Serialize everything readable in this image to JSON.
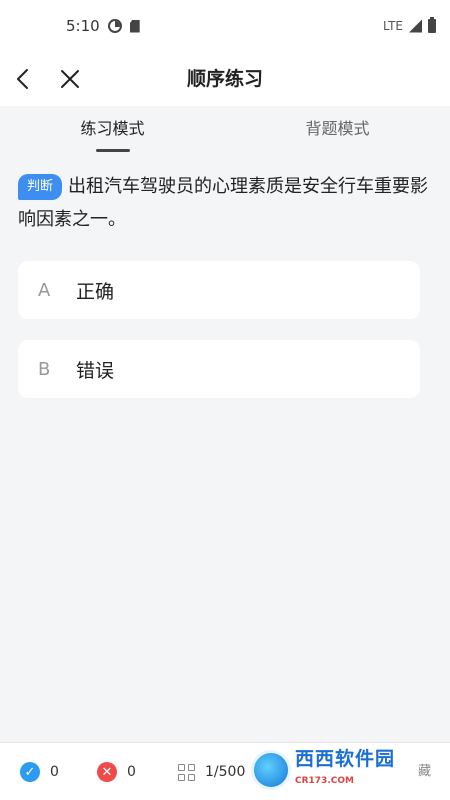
{
  "status": {
    "time": "5:10",
    "network": "LTE"
  },
  "nav": {
    "title": "顺序练习"
  },
  "tabs": [
    {
      "label": "练习模式",
      "active": true
    },
    {
      "label": "背题模式",
      "active": false
    }
  ],
  "question": {
    "badge": "判断",
    "text": "出租汽车驾驶员的心理素质是安全行车重要影响因素之一。"
  },
  "options": [
    {
      "letter": "A",
      "text": "正确"
    },
    {
      "letter": "B",
      "text": "错误"
    }
  ],
  "bottom": {
    "correct_count": "0",
    "wrong_count": "0",
    "progress": "1/500",
    "right_label": "藏"
  },
  "watermark": {
    "name": "西西软件园",
    "site": "CR173.COM"
  },
  "colors": {
    "accent": "#3d8ef0",
    "correct": "#2d9cf0",
    "wrong": "#ef4b4b",
    "background": "#f4f5f7"
  }
}
